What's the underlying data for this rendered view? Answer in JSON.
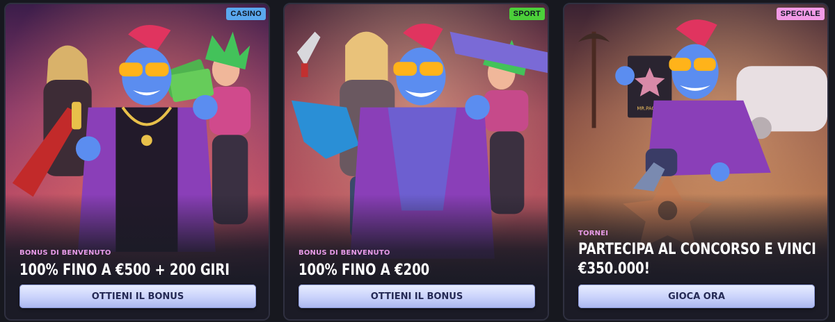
{
  "cards": [
    {
      "badge": "CASINO",
      "eyebrow": "BONUS DI BENVENUTO",
      "headline": "100% FINO A €500 + 200 GIRI",
      "cta": "OTTIENI IL BONUS"
    },
    {
      "badge": "SPORT",
      "eyebrow": "BONUS DI BENVENUTO",
      "headline": "100% FINO A €200",
      "cta": "OTTIENI IL BONUS"
    },
    {
      "badge": "SPECIALE",
      "eyebrow": "TORNEI",
      "headline": "PARTECIPA AL CONCORSO E VINCI €350.000!",
      "cta": "GIOCA ORA",
      "sign_text": "MR.PACHO"
    }
  ],
  "colors": {
    "casino_badge": "#5aa8ee",
    "sport_badge": "#4ccf3a",
    "speciale_badge": "#f29ae6",
    "eyebrow": "#e79be8",
    "button": "#c9d2fb"
  }
}
